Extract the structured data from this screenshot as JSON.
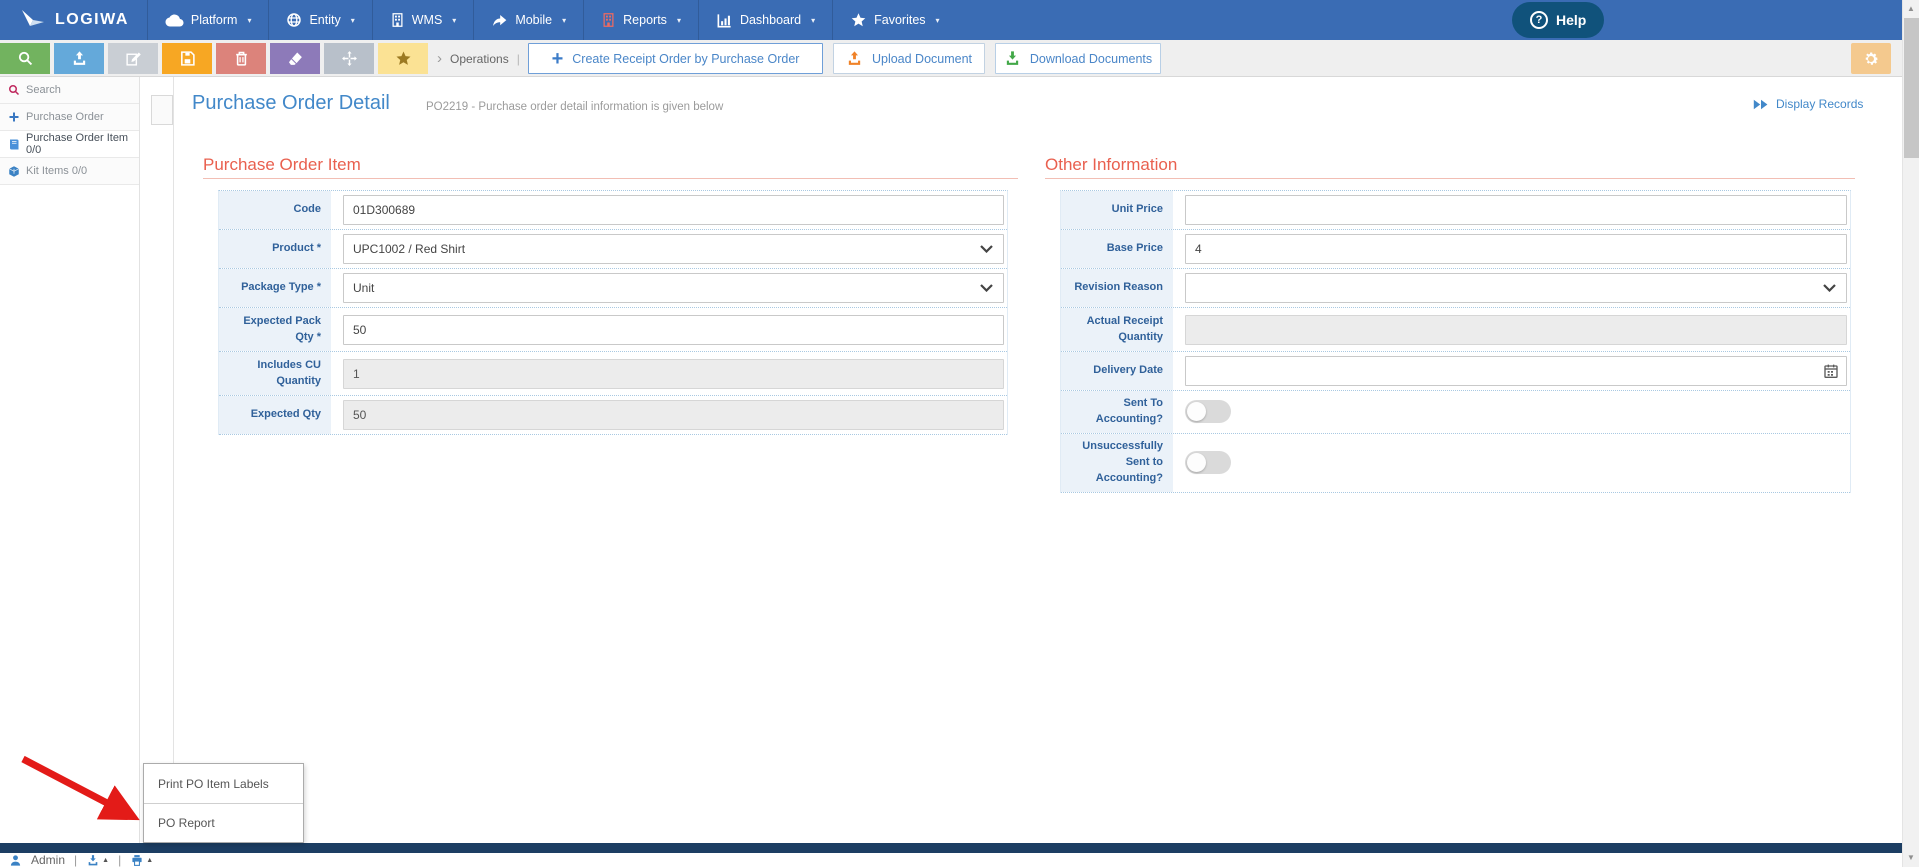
{
  "topnav": {
    "brand": "LOGIWA",
    "items": [
      {
        "label": "Platform",
        "icon": "cloud-icon"
      },
      {
        "label": "Entity",
        "icon": "globe-icon"
      },
      {
        "label": "WMS",
        "icon": "building-icon"
      },
      {
        "label": "Mobile",
        "icon": "mobile-arrow-icon"
      },
      {
        "label": "Reports",
        "icon": "reports-building-icon"
      },
      {
        "label": "Dashboard",
        "icon": "dashboard-chart-icon"
      },
      {
        "label": "Favorites",
        "icon": "star-icon"
      }
    ],
    "help_label": "Help"
  },
  "toolbar": {
    "breadcrumb_chevron": "›",
    "breadcrumb": "Operations",
    "breadcrumb_divider": "|",
    "icon_buttons": [
      "search",
      "upload",
      "edit",
      "save",
      "delete",
      "erase",
      "move",
      "favorite"
    ],
    "create_receipt_label": "Create Receipt Order by Purchase Order",
    "upload_document_label": "Upload Document",
    "download_documents_label": "Download Documents"
  },
  "sidebar": {
    "items": [
      {
        "label": "Search",
        "icon": "search-icon"
      },
      {
        "label": "Purchase Order",
        "icon": "plus-icon"
      },
      {
        "label": "Purchase Order Item 0/0",
        "icon": "book-icon"
      },
      {
        "label": "Kit Items 0/0",
        "icon": "cube-icon"
      }
    ]
  },
  "page": {
    "title": "Purchase Order Detail",
    "subtitle": "PO2219 - Purchase order detail information is given below",
    "display_records": "Display Records"
  },
  "form_left": {
    "title": "Purchase Order Item",
    "rows": [
      {
        "label": "Code",
        "value": "01D300689",
        "type": "text"
      },
      {
        "label": "Product *",
        "value": "UPC1002 / Red Shirt",
        "type": "select"
      },
      {
        "label": "Package Type *",
        "value": "Unit",
        "type": "select"
      },
      {
        "label": "Expected Pack Qty *",
        "value": "50",
        "type": "text"
      },
      {
        "label": "Includes CU Quantity",
        "value": "1",
        "type": "text-disabled"
      },
      {
        "label": "Expected Qty",
        "value": "50",
        "type": "text-disabled"
      }
    ]
  },
  "form_right": {
    "title": "Other Information",
    "rows": [
      {
        "label": "Unit Price",
        "value": "",
        "type": "text"
      },
      {
        "label": "Base Price",
        "value": "4",
        "type": "text"
      },
      {
        "label": "Revision Reason",
        "value": "",
        "type": "select"
      },
      {
        "label": "Actual Receipt Quantity",
        "value": "",
        "type": "text-disabled"
      },
      {
        "label": "Delivery Date",
        "value": "",
        "type": "date"
      },
      {
        "label": "Sent To Accounting?",
        "value": "off",
        "type": "toggle"
      },
      {
        "label": "Unsuccessfully Sent to Accounting?",
        "value": "off",
        "type": "toggle"
      }
    ]
  },
  "context_menu": {
    "items": [
      {
        "label": "Print PO Item Labels"
      },
      {
        "label": "PO Report"
      }
    ]
  },
  "footer": {
    "user": "Admin",
    "divider": "|"
  },
  "colors": {
    "nav_blue": "#3a6cb4",
    "accent_blue": "#4288c9",
    "section_red": "#e9604f",
    "label_blue": "#30619a",
    "toolbar_green": "#72b35f",
    "toolbar_orange": "#f7a723",
    "toolbar_red": "#dc837b",
    "toolbar_purple": "#8d7ab9",
    "upload_icon_orange": "#f08228",
    "download_icon_green": "#42a848",
    "arrow_red": "#e31b18",
    "dark_bottom_bar": "#1c3e63"
  }
}
